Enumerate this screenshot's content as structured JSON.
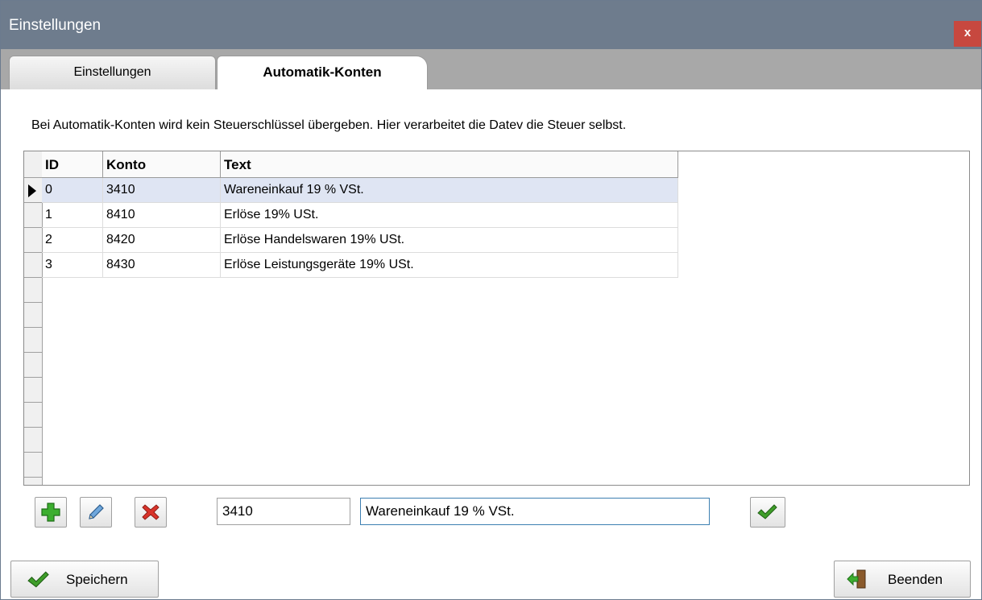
{
  "window": {
    "title": "Einstellungen",
    "close_label": "x"
  },
  "tabs": [
    {
      "label": "Einstellungen"
    },
    {
      "label": "Automatik-Konten"
    }
  ],
  "info_text": "Bei Automatik-Konten wird kein Steuerschlüssel übergeben. Hier verarbeitet die Datev die Steuer selbst.",
  "grid": {
    "columns": [
      "ID",
      "Konto",
      "Text"
    ],
    "rows": [
      {
        "id": "0",
        "konto": "3410",
        "text": "Wareneinkauf 19 % VSt."
      },
      {
        "id": "1",
        "konto": "8410",
        "text": "Erlöse 19% USt."
      },
      {
        "id": "2",
        "konto": "8420",
        "text": "Erlöse Handelswaren 19% USt."
      },
      {
        "id": "3",
        "konto": "8430",
        "text": "Erlöse Leistungsgeräte 19% USt."
      }
    ],
    "selected_row": 0
  },
  "editor": {
    "konto_value": "3410",
    "text_value": "Wareneinkauf 19 % VSt."
  },
  "buttons": {
    "save_label": "Speichern",
    "exit_label": "Beenden"
  },
  "colors": {
    "titlebar": "#6e7c8d",
    "close": "#c7483f",
    "selected_row": "#dfe5f3",
    "add_icon": "#3cae2f",
    "delete_icon": "#d9332a",
    "check_icon": "#3f9e2a"
  }
}
